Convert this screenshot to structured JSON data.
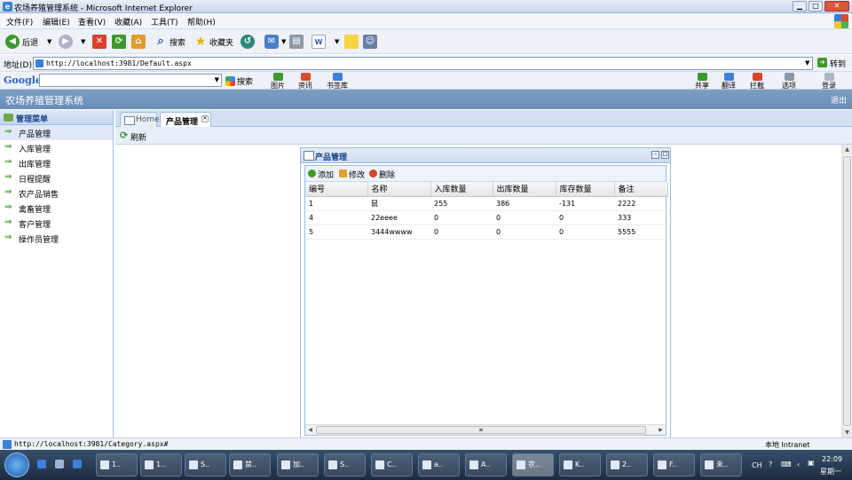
{
  "window": {
    "title": "农场养殖管理系统 - Microsoft Internet Explorer"
  },
  "menu": [
    "文件(F)",
    "编辑(E)",
    "查看(V)",
    "收藏(A)",
    "工具(T)",
    "帮助(H)"
  ],
  "toolbar": {
    "back": "后退",
    "search": "搜索",
    "favorites": "收藏夹"
  },
  "address": {
    "label": "地址(D)",
    "url": "http://localhost:3981/Default.aspx",
    "go": "转到"
  },
  "google": {
    "logo": "Google",
    "search": "搜索",
    "buttons": [
      "图片",
      "资讯",
      "书签库",
      "共享",
      "翻译",
      "拦截",
      "选项",
      "登录"
    ]
  },
  "app": {
    "title": "农场养殖管理系统",
    "logout": "退出"
  },
  "sidebar": {
    "title": "管理菜单",
    "items": [
      "产品管理",
      "入库管理",
      "出库管理",
      "日程提醒",
      "农产品销售",
      "禽畜管理",
      "客户管理",
      "操作员管理"
    ]
  },
  "tabs": {
    "home": "Home",
    "product": "产品管理"
  },
  "subbar": {
    "refresh": "刷新"
  },
  "panel": {
    "title": "产品管理",
    "actions": {
      "add": "添加",
      "edit": "修改",
      "delete": "删除"
    },
    "columns": [
      "编号",
      "名称",
      "入库数量",
      "出库数量",
      "库存数量",
      "备注"
    ],
    "rows": [
      [
        "1",
        "鼠",
        "255",
        "386",
        "-131",
        "2222"
      ],
      [
        "4",
        "22eeee",
        "0",
        "0",
        "0",
        "333"
      ],
      [
        "5",
        "3444wwww",
        "0",
        "0",
        "0",
        "5555"
      ]
    ]
  },
  "status": {
    "url": "http://localhost:3981/Category.aspx#",
    "zone": "本地 Intranet"
  },
  "taskbar": {
    "items": [
      "1..",
      "1..",
      "S..",
      "禁..",
      "加..",
      "S..",
      "C..",
      "a..",
      "A..",
      "农..",
      "K..",
      "2..",
      "F..",
      "未.."
    ],
    "lang": "CH",
    "time": "22:09",
    "day": "星期一"
  }
}
